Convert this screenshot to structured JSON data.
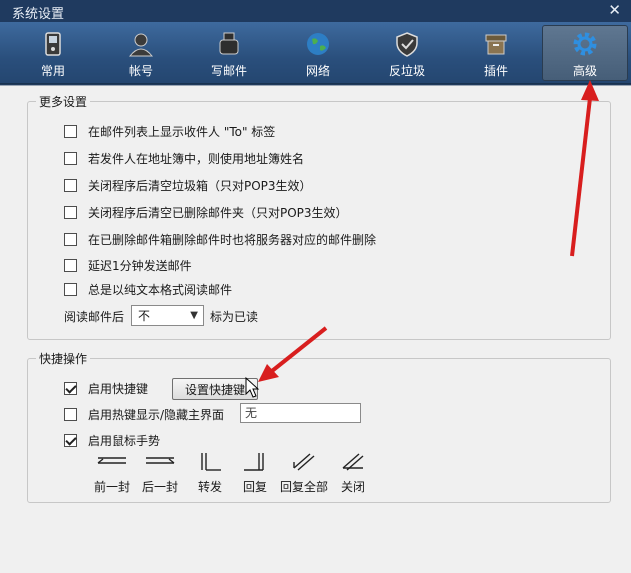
{
  "window": {
    "title": "系统设置",
    "close_glyph": "✕"
  },
  "toolbar": {
    "items": [
      {
        "label": "常用",
        "icon": "device-icon"
      },
      {
        "label": "帐号",
        "icon": "user-icon"
      },
      {
        "label": "写邮件",
        "icon": "inkpot-icon"
      },
      {
        "label": "网络",
        "icon": "globe-icon"
      },
      {
        "label": "反垃圾",
        "icon": "shield-icon"
      },
      {
        "label": "插件",
        "icon": "box-icon"
      },
      {
        "label": "高级",
        "icon": "gear-icon",
        "active": true
      }
    ]
  },
  "more_settings": {
    "title": "更多设置",
    "options": [
      {
        "label": "在邮件列表上显示收件人 \"To\" 标签",
        "checked": false
      },
      {
        "label": "若发件人在地址簿中，则使用地址簿姓名",
        "checked": false
      },
      {
        "label": "关闭程序后清空垃圾箱（只对POP3生效）",
        "checked": false
      },
      {
        "label": "关闭程序后清空已删除邮件夹（只对POP3生效）",
        "checked": false
      },
      {
        "label": "在已删除邮件箱删除邮件时也将服务器对应的邮件删除",
        "checked": false
      },
      {
        "label": "延迟1分钟发送邮件",
        "checked": false
      },
      {
        "label": "总是以纯文本格式阅读邮件",
        "checked": false
      }
    ],
    "read_after_label": "阅读邮件后",
    "read_after_value": "不",
    "mark_read_label": "标为已读"
  },
  "shortcuts": {
    "title": "快捷操作",
    "enable_hotkey": {
      "label": "启用快捷键",
      "checked": true
    },
    "set_hotkey_button": "设置快捷键",
    "hotkey_toggle": {
      "label": "启用热键显示/隐藏主界面",
      "checked": false
    },
    "hotkey_value": "无",
    "mouse_gesture": {
      "label": "启用鼠标手势",
      "checked": true
    },
    "gestures": [
      "前一封",
      "后一封",
      "转发",
      "回复",
      "回复全部",
      "关闭"
    ]
  },
  "colors": {
    "accent_arrow": "#d81e1e",
    "titlebar": "#1f3a5f",
    "toolbar": "#2a4f7c"
  }
}
